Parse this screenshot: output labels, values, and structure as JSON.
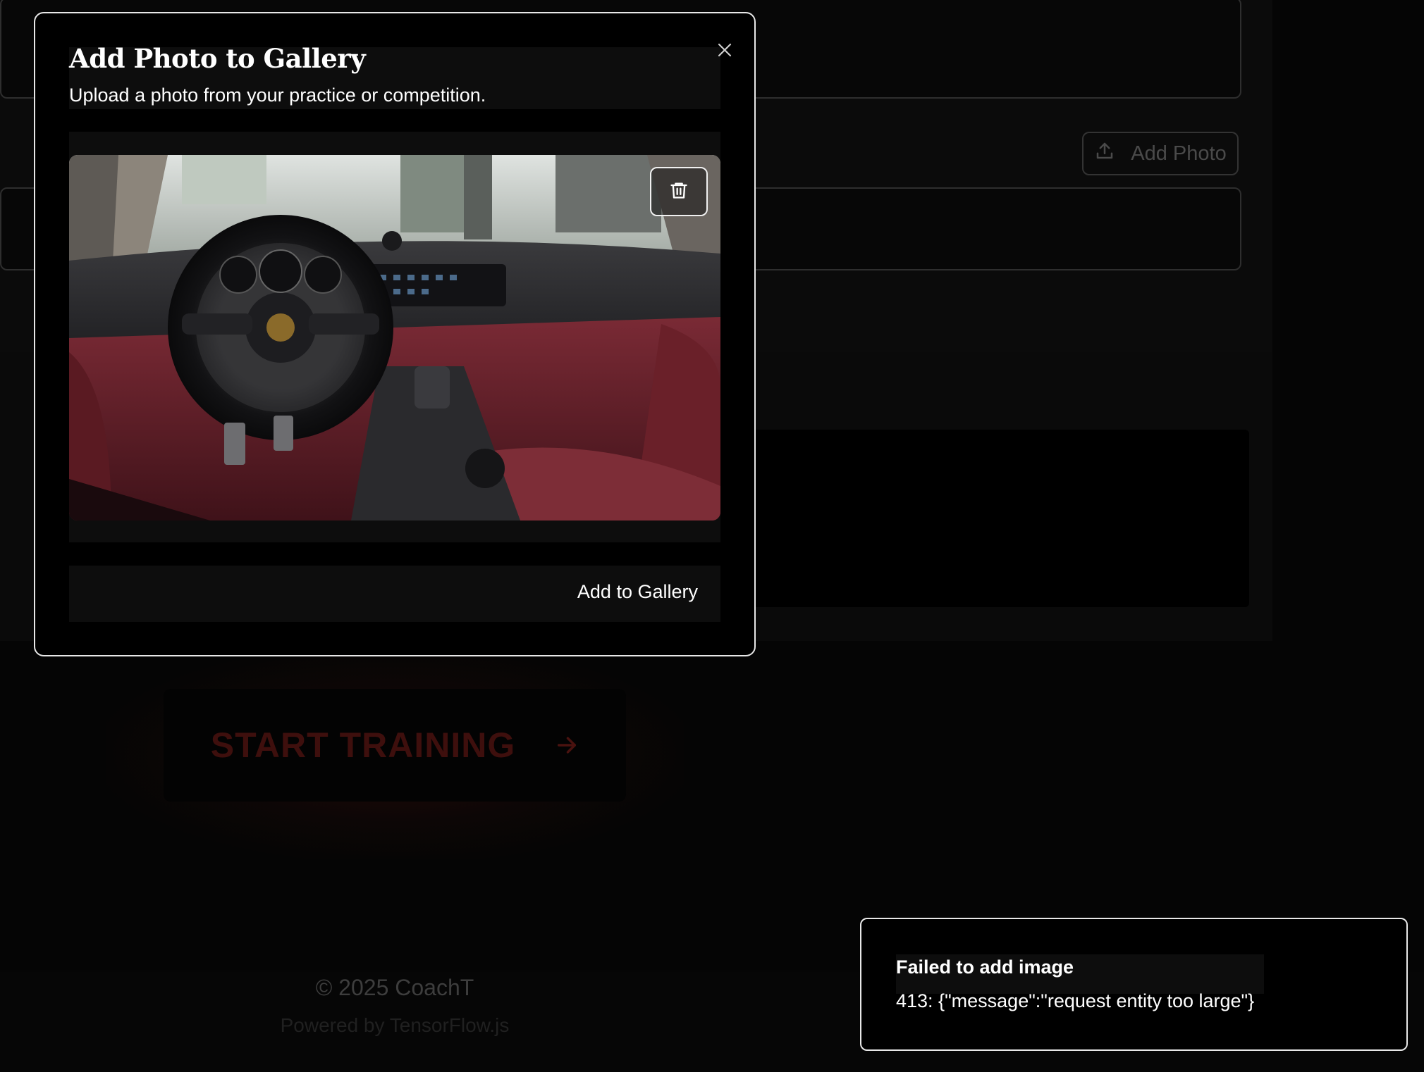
{
  "background": {
    "add_photo_label": "Add Photo",
    "start_training_label": "START TRAINING",
    "footer_copyright": "© 2025 CoachT",
    "footer_powered": "Powered by TensorFlow.js"
  },
  "modal": {
    "title": "Add Photo to Gallery",
    "subtitle": "Upload a photo from your practice or competition.",
    "add_button_label": "Add to Gallery"
  },
  "toast": {
    "title": "Failed to add image",
    "message": "413: {\"message\":\"request entity too large\"}"
  },
  "icons": {
    "close": "close-icon",
    "delete": "trash-icon",
    "upload": "upload-icon",
    "arrow": "arrow-right-icon"
  }
}
